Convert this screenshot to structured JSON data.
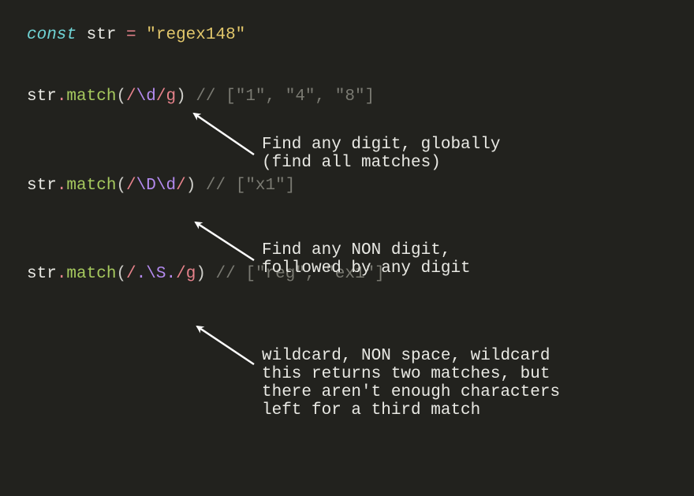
{
  "line1": {
    "const": "const",
    "sp1": " ",
    "ident": "str",
    "sp2": " ",
    "eq": "=",
    "sp3": " ",
    "str": "\"regex148\""
  },
  "ex1": {
    "obj": "str",
    "dot": ".",
    "method": "match",
    "lp": "(",
    "sl1": "/",
    "esc": "\\d",
    "sl2": "/",
    "flag": "g",
    "rp": ")",
    "sp": " ",
    "cmt": "// [\"1\", \"4\", \"8\"]",
    "annot": "Find any digit, globally\n(find all matches)"
  },
  "ex2": {
    "obj": "str",
    "dot": ".",
    "method": "match",
    "lp": "(",
    "sl1": "/",
    "esc1": "\\D",
    "esc2": "\\d",
    "sl2": "/",
    "rp": ")",
    "sp": " ",
    "cmt": "// [\"x1\"]",
    "annot": "Find any NON digit,\nfollowed by any digit"
  },
  "ex3": {
    "obj": "str",
    "dot": ".",
    "method": "match",
    "lp": "(",
    "sl1": "/",
    "dot1": ".",
    "esc": "\\S",
    "dot2": ".",
    "sl2": "/",
    "flag": "g",
    "rp": ")",
    "sp": " ",
    "cmt": "// [\"reg\", \"ex1\"]",
    "annot": "wildcard, NON space, wildcard\nthis returns two matches, but\nthere aren't enough characters\nleft for a third match"
  }
}
